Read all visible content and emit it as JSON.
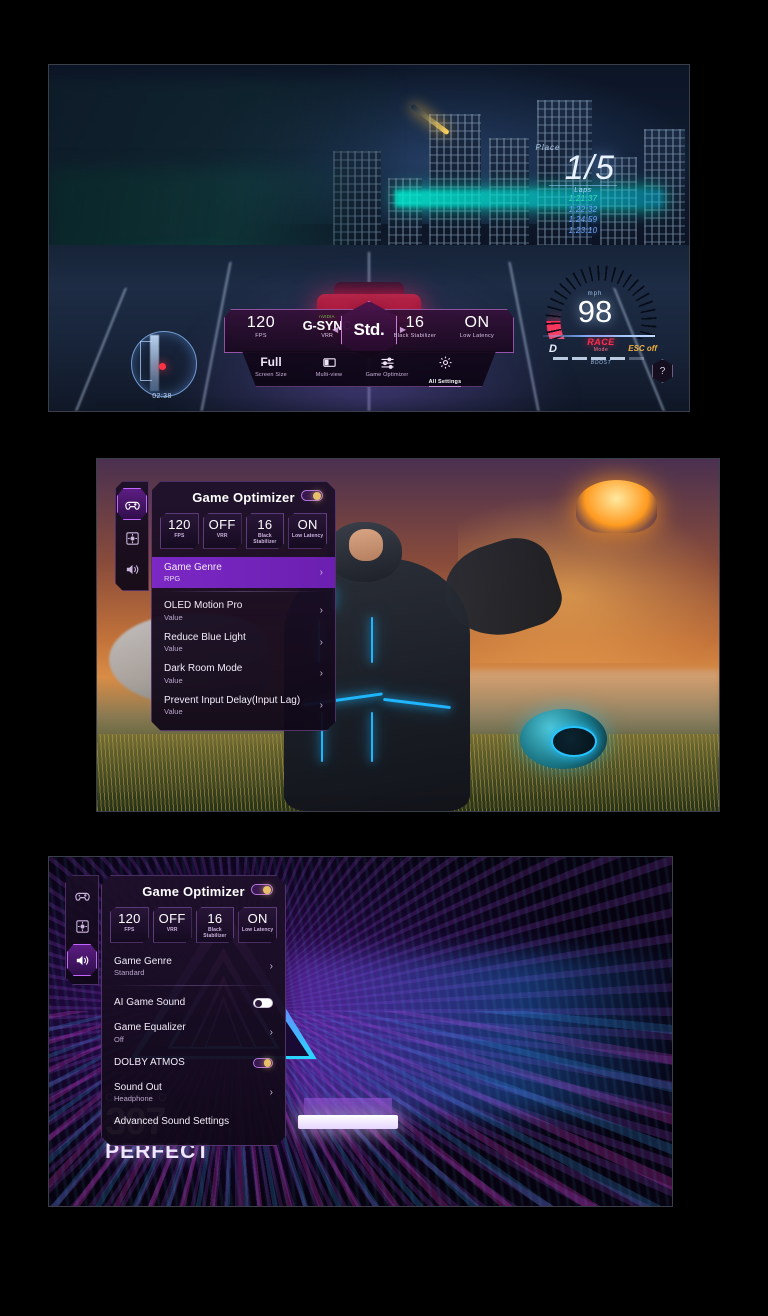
{
  "page": {
    "background": "#000000",
    "panels": [
      "racing-tv",
      "rpg-tv",
      "rhythm-tv"
    ]
  },
  "racing": {
    "scene_label": "night city racing game",
    "minimap": {
      "time": "02:38"
    },
    "place": {
      "label": "Place",
      "position": "1",
      "separator": "/",
      "total": "5"
    },
    "laps": {
      "header": "Laps",
      "times": [
        "1:21:37",
        "1:22:32",
        "1:24:59",
        "1:23:10"
      ]
    },
    "speedometer": {
      "unit": "mph",
      "value": "98",
      "mode_name": "RACE",
      "mode_sub": "Mode",
      "gear": "D",
      "esc": "ESC off",
      "boost_label": "BOOST"
    },
    "quick_menu": {
      "stats": [
        {
          "value": "120",
          "key": "FPS"
        },
        {
          "brand": "nVIDIA",
          "value": "G-SYNC",
          "key": "VRR"
        },
        {
          "value": "16",
          "key": "Black Stabilizer"
        },
        {
          "value": "ON",
          "key": "Low Latency"
        }
      ],
      "center": {
        "value": "Std.",
        "left_arrow": "◀",
        "right_arrow": "▶"
      },
      "actions": [
        {
          "icon": "screen-size-icon",
          "value": "Full",
          "label": "Screen Size",
          "active": false
        },
        {
          "icon": "multi-view-icon",
          "value": "",
          "label": "Multi-view",
          "active": false
        },
        {
          "icon": "sliders-icon",
          "value": "",
          "label": "Game Optimizer",
          "active": false
        },
        {
          "icon": "gear-icon",
          "value": "",
          "label": "All Settings",
          "active": true
        }
      ],
      "help": "?"
    }
  },
  "rpg": {
    "scene_label": "sci-fi character with glowing suit at sunset",
    "sidebar": [
      {
        "icon": "gamepad-icon",
        "name": "game-tab",
        "selected": true
      },
      {
        "icon": "picture-icon",
        "name": "picture-tab",
        "selected": false
      },
      {
        "icon": "speaker-icon",
        "name": "sound-tab",
        "selected": false
      }
    ],
    "title": "Game Optimizer",
    "power_toggle": "on",
    "stats": [
      {
        "value": "120",
        "key": "FPS"
      },
      {
        "value": "OFF",
        "key": "VRR"
      },
      {
        "value": "16",
        "key": "Black Stabilizer"
      },
      {
        "value": "ON",
        "key": "Low Latency"
      }
    ],
    "menu": [
      {
        "label": "Game Genre",
        "sub": "RPG",
        "control": "chevron",
        "selected": true
      },
      {
        "label": "OLED Motion Pro",
        "sub": "Value",
        "control": "chevron",
        "selected": false
      },
      {
        "label": "Reduce Blue Light",
        "sub": "Value",
        "control": "chevron",
        "selected": false
      },
      {
        "label": "Dark Room Mode",
        "sub": "Value",
        "control": "chevron",
        "selected": false
      },
      {
        "label": "Prevent Input Delay(Input Lag)",
        "sub": "Value",
        "control": "chevron",
        "selected": false
      }
    ],
    "chevron": "›"
  },
  "rhythm": {
    "scene_label": "neon triangle tunnel rhythm game",
    "hud": {
      "combo_label": "COMBO",
      "combo_value": "307",
      "judgement": "PERFECT"
    },
    "sidebar": [
      {
        "icon": "gamepad-icon",
        "name": "game-tab",
        "selected": false
      },
      {
        "icon": "picture-icon",
        "name": "picture-tab",
        "selected": false
      },
      {
        "icon": "speaker-icon",
        "name": "sound-tab",
        "selected": true
      }
    ],
    "title": "Game Optimizer",
    "power_toggle": "on",
    "stats": [
      {
        "value": "120",
        "key": "FPS"
      },
      {
        "value": "OFF",
        "key": "VRR"
      },
      {
        "value": "16",
        "key": "Black Stabilizer"
      },
      {
        "value": "ON",
        "key": "Low Latency"
      }
    ],
    "menu": [
      {
        "label": "Game Genre",
        "sub": "Standard",
        "control": "chevron",
        "selected": false
      },
      {
        "label": "AI Game Sound",
        "sub": "",
        "control": "switch-off",
        "selected": false
      },
      {
        "label": "Game Equalizer",
        "sub": "Off",
        "control": "chevron",
        "selected": false
      },
      {
        "label": "DOLBY ATMOS",
        "sub": "",
        "control": "switch-on",
        "selected": false
      },
      {
        "label": "Sound Out",
        "sub": "Headphone",
        "control": "chevron",
        "selected": false
      },
      {
        "label": "Advanced Sound Settings",
        "sub": "",
        "control": "none",
        "selected": false
      }
    ],
    "chevron": "›"
  },
  "colors": {
    "accent_purple": "#c264ff",
    "selected_row": "#7b28c4",
    "toggle_knob": "#e8c06a",
    "neon_blue": "#1fb6ff",
    "race_red": "#ff2d4e"
  }
}
